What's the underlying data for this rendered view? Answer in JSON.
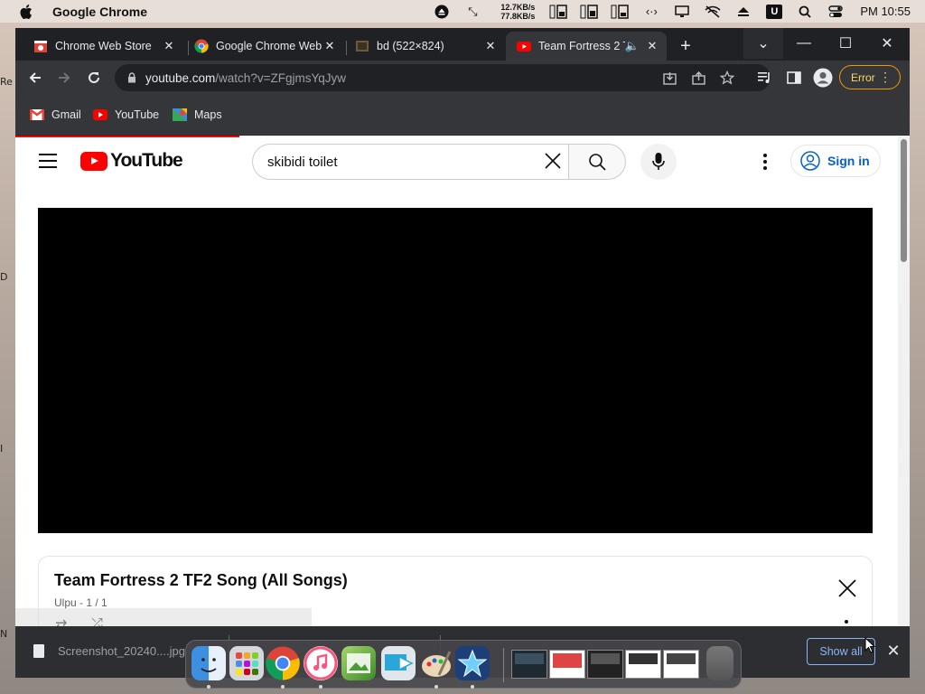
{
  "menubar": {
    "app_name": "Google Chrome",
    "net_up": "12.7KB/s",
    "net_down": "77.8KB/s",
    "u_badge": "U",
    "clock": "PM 10:55"
  },
  "desktop": {
    "edge_labels": [
      "Re",
      "D",
      "I",
      "N"
    ]
  },
  "tabs": [
    {
      "title": "Chrome Web Store",
      "favicon": "chrome-web-store-icon"
    },
    {
      "title": "Google Chrome Web",
      "favicon": "chrome-icon"
    },
    {
      "title": "bd (522×824)",
      "favicon": "image-icon"
    },
    {
      "title": "Team Fortress 2 T",
      "favicon": "youtube-icon",
      "active": true
    }
  ],
  "toolbar": {
    "url_host": "youtube.com",
    "url_path": "/watch?v=ZFgjmsYqJyw",
    "error_label": "Error"
  },
  "bookmarks": [
    {
      "label": "Gmail",
      "icon": "gmail-icon"
    },
    {
      "label": "YouTube",
      "icon": "youtube-icon"
    },
    {
      "label": "Maps",
      "icon": "maps-icon"
    }
  ],
  "youtube": {
    "logo_text": "YouTube",
    "search_query": "skibidi toilet",
    "signin_label": "Sign in",
    "accent_color": "#ff0000",
    "link_color": "#065fd4"
  },
  "playlist": {
    "title": "Team Fortress 2 TF2 Song (All Songs)",
    "subtitle": "Ulpu - 1 / 1"
  },
  "downloads": {
    "file_name": "Screenshot_20240....jpg",
    "show_all_label": "Show all"
  },
  "dock": {
    "apps": [
      "finder-icon",
      "launchpad-icon",
      "chrome-icon",
      "music-icon",
      "preview-icon",
      "migration-icon",
      "paint-icon",
      "imovie-icon"
    ],
    "thumbnails": [
      "window-thumb-1",
      "window-thumb-2",
      "window-thumb-3",
      "window-thumb-4",
      "window-thumb-5"
    ],
    "trash": "trash-icon"
  }
}
